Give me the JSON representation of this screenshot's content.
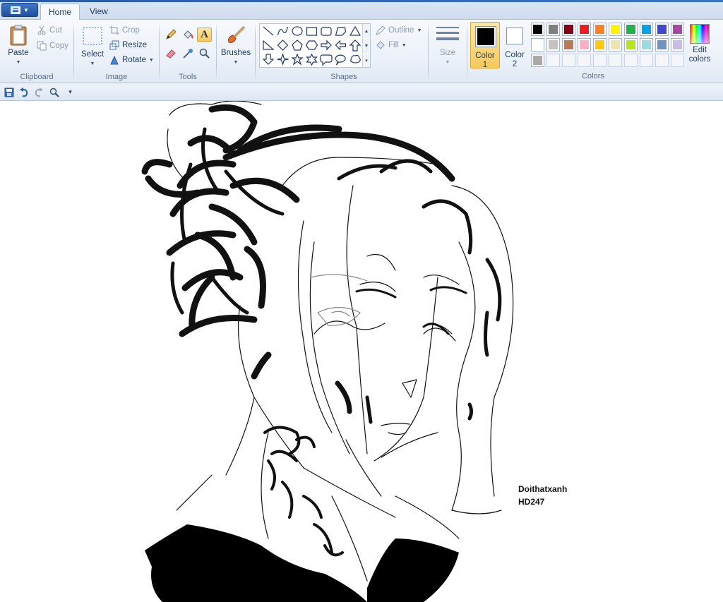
{
  "tabs": {
    "home": "Home",
    "view": "View"
  },
  "file_menu": {
    "icon": "paint-menu-icon"
  },
  "clipboard": {
    "paste": "Paste",
    "cut": "Cut",
    "copy": "Copy",
    "label": "Clipboard"
  },
  "image": {
    "select": "Select",
    "crop": "Crop",
    "resize": "Resize",
    "rotate": "Rotate",
    "label": "Image"
  },
  "tools": {
    "label": "Tools",
    "items": [
      "pencil-icon",
      "fill-bucket-icon",
      "text-icon",
      "eraser-icon",
      "color-picker-icon",
      "magnifier-icon"
    ],
    "text_glyph": "A",
    "active": "text-icon"
  },
  "brushes": {
    "label": "Brushes"
  },
  "shapes": {
    "label": "Shapes",
    "outline": "Outline",
    "fill": "Fill",
    "items": [
      "line",
      "curve",
      "oval",
      "rectangle",
      "rounded-rectangle",
      "polygon",
      "triangle",
      "right-triangle",
      "diamond",
      "pentagon",
      "hexagon",
      "right-arrow",
      "left-arrow",
      "up-arrow",
      "down-arrow",
      "four-point-star",
      "five-point-star",
      "six-point-star",
      "rounded-callout",
      "oval-callout",
      "cloud-callout"
    ]
  },
  "size": {
    "label": "Size"
  },
  "colors": {
    "label": "Colors",
    "color1_label": "Color",
    "color1_num": "1",
    "color1_value": "#000000",
    "color2_label": "Color",
    "color2_num": "2",
    "color2_value": "#ffffff",
    "edit_label_1": "Edit",
    "edit_label_2": "colors",
    "palette_row1": [
      "#000000",
      "#7f7f7f",
      "#880015",
      "#ed1c24",
      "#ff7f27",
      "#fff200",
      "#22b14c",
      "#00a2e8",
      "#3f48cc",
      "#a349a4"
    ],
    "palette_row2": [
      "#ffffff",
      "#c3c3c3",
      "#b97a57",
      "#ffaec9",
      "#ffc90e",
      "#efe4b0",
      "#b5e61d",
      "#99d9ea",
      "#7092be",
      "#c8bfe7"
    ],
    "palette_row3": [
      "#aaaaaa",
      "",
      "",
      "",
      "",
      "",
      "",
      "",
      "",
      ""
    ]
  },
  "qat": {
    "items": [
      "save-icon",
      "undo-icon",
      "redo-icon",
      "zoom-icon",
      "customize-qat-icon"
    ]
  },
  "canvas": {
    "signature_line1": "Doithatxanh",
    "signature_line2": "HD247"
  }
}
